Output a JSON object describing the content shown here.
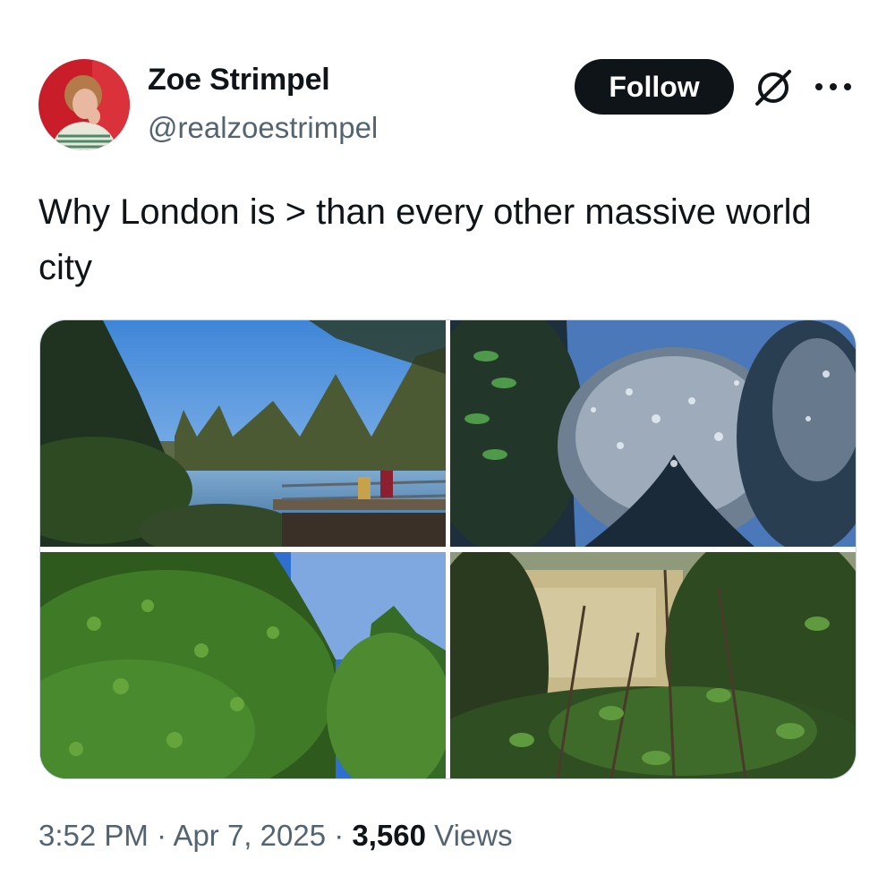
{
  "author": {
    "display_name": "Zoe Strimpel",
    "handle": "@realzoestrimpel",
    "avatar_icon": "profile-avatar"
  },
  "actions": {
    "follow_label": "Follow",
    "grok_icon": "grok-icon",
    "more_icon": "more-horizontal-icon"
  },
  "tweet": {
    "text": "Why London is > than every other massive world city"
  },
  "media": {
    "photo_count": 4,
    "photos": [
      {
        "subject": "pond with bridge and trees"
      },
      {
        "subject": "blossoming tree against blue sky"
      },
      {
        "subject": "green ivy bushes"
      },
      {
        "subject": "undergrowth with leaves"
      }
    ]
  },
  "meta": {
    "time": "3:52 PM",
    "separator": "·",
    "date": "Apr 7, 2025",
    "views_count": "3,560",
    "views_label": "Views"
  },
  "colors": {
    "text_primary": "#0f1419",
    "text_secondary": "#536471",
    "follow_bg": "#0f1419",
    "border": "#cfd9de"
  }
}
